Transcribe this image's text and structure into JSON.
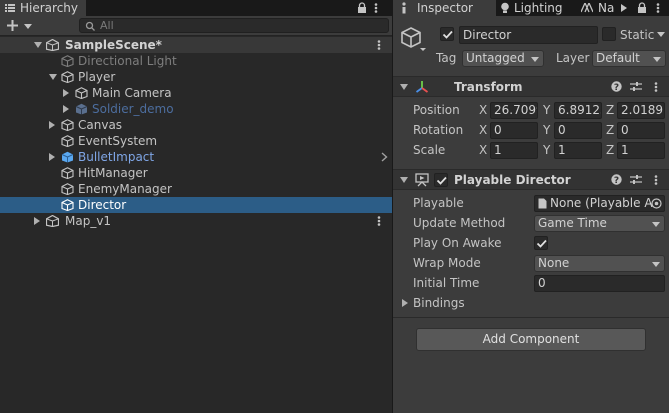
{
  "hierarchy": {
    "tab_label": "Hierarchy",
    "search_placeholder": "All",
    "scene": "SampleScene*",
    "items": [
      {
        "label": "Directional Light",
        "color": "#7e7e7e"
      },
      {
        "label": "Player",
        "color": "#c4c4c4"
      },
      {
        "label": "Main Camera",
        "color": "#c4c4c4"
      },
      {
        "label": "Soldier_demo",
        "color": "#4c6d9e"
      },
      {
        "label": "Canvas",
        "color": "#c4c4c4"
      },
      {
        "label": "EventSystem",
        "color": "#c4c4c4"
      },
      {
        "label": "BulletImpact",
        "color": "#7fa6e6"
      },
      {
        "label": "HitManager",
        "color": "#c4c4c4"
      },
      {
        "label": "EnemyManager",
        "color": "#c4c4c4"
      },
      {
        "label": "Director",
        "color": "#ffffff"
      }
    ],
    "map": "Map_v1"
  },
  "inspector": {
    "tabs": [
      "Inspector",
      "Lighting",
      "Na"
    ],
    "object": {
      "name": "Director",
      "static_label": "Static",
      "tag_label": "Tag",
      "tag_value": "Untagged",
      "layer_label": "Layer",
      "layer_value": "Default"
    },
    "transform": {
      "title": "Transform",
      "position_label": "Position",
      "rotation_label": "Rotation",
      "scale_label": "Scale",
      "axes": [
        "X",
        "Y",
        "Z"
      ],
      "position": [
        "26.7099",
        "6.89125",
        "2.01891"
      ],
      "rotation": [
        "0",
        "0",
        "0"
      ],
      "scale": [
        "1",
        "1",
        "1"
      ]
    },
    "playable_director": {
      "title": "Playable Director",
      "playable_label": "Playable",
      "playable_value": "None (Playable A",
      "update_method_label": "Update Method",
      "update_method_value": "Game Time",
      "play_on_awake_label": "Play On Awake",
      "wrap_mode_label": "Wrap Mode",
      "wrap_mode_value": "None",
      "initial_time_label": "Initial Time",
      "initial_time_value": "0",
      "bindings_label": "Bindings"
    },
    "add_component_label": "Add Component"
  },
  "colors": {
    "selection": "#2c5d87",
    "panel": "#282828",
    "inspector_bg": "#3c3c3c"
  }
}
